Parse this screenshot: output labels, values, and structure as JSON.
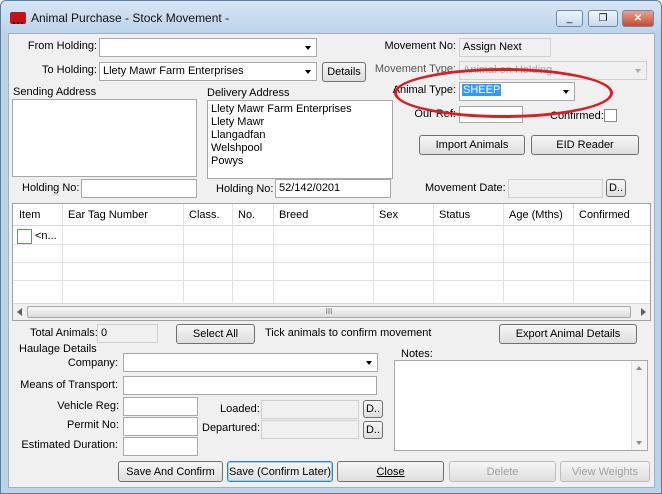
{
  "window": {
    "title": "Animal Purchase - Stock Movement -",
    "minimize_glyph": "_",
    "restore_glyph": "❐",
    "close_glyph": "✕"
  },
  "colors": {
    "accent": "#d81f26",
    "selection": "#3399ff"
  },
  "form": {
    "from_holding_label": "From Holding:",
    "from_holding_value": "",
    "to_holding_label": "To Holding:",
    "to_holding_value": "Llety Mawr Farm Enterprises",
    "details_button": "Details",
    "movement_no_label": "Movement No:",
    "movement_no_value": "Assign Next",
    "movement_type_label": "Movement Type:",
    "movement_type_value": "Animal on Holding",
    "animal_type_label": "Animal Type:",
    "animal_type_value": "SHEEP",
    "our_ref_label": "Our Ref:",
    "our_ref_value": "",
    "confirmed_label": "Confirmed:",
    "sending_address_label": "Sending Address",
    "sending_address_value": "",
    "delivery_address_label": "Delivery Address",
    "delivery_address_lines": [
      "Llety Mawr Farm Enterprises",
      "Llety Mawr",
      "Llangadfan",
      "Welshpool",
      "Powys"
    ],
    "import_animals_button": "Import Animals",
    "eid_reader_button": "EID Reader",
    "holding_no_label": "Holding No:",
    "sending_holding_no_value": "",
    "delivery_holding_no_value": "52/142/0201",
    "movement_date_label": "Movement Date:",
    "movement_date_value": "",
    "date_button": "D.."
  },
  "grid": {
    "columns": [
      "Item",
      "Ear Tag Number",
      "Class.",
      "No.",
      "Breed",
      "Sex",
      "Status",
      "Age (Mths)",
      "Confirmed"
    ],
    "new_row_text": "<n...",
    "scroll_thumb": "III"
  },
  "footer": {
    "total_animals_label": "Total Animals:",
    "total_animals_value": "0",
    "select_all_button": "Select All",
    "tick_hint": "Tick animals to confirm movement",
    "export_button": "Export Animal Details",
    "haulage_label": "Haulage Details",
    "company_label": "Company:",
    "company_value": "",
    "transport_label": "Means of Transport:",
    "transport_value": "",
    "vehicle_reg_label": "Vehicle Reg:",
    "vehicle_reg_value": "",
    "permit_label": "Permit No:",
    "permit_value": "",
    "duration_label": "Estimated Duration:",
    "duration_value": "",
    "loaded_label": "Loaded:",
    "loaded_value": "",
    "departured_label": "Departured:",
    "departured_value": "",
    "loaded_button": "D..",
    "departured_button": "D..",
    "notes_label": "Notes:",
    "notes_value": ""
  },
  "buttons": {
    "save_confirm": "Save And Confirm",
    "save_later": "Save (Confirm Later)",
    "close": "Close",
    "delete": "Delete",
    "view_weights": "View Weights"
  }
}
